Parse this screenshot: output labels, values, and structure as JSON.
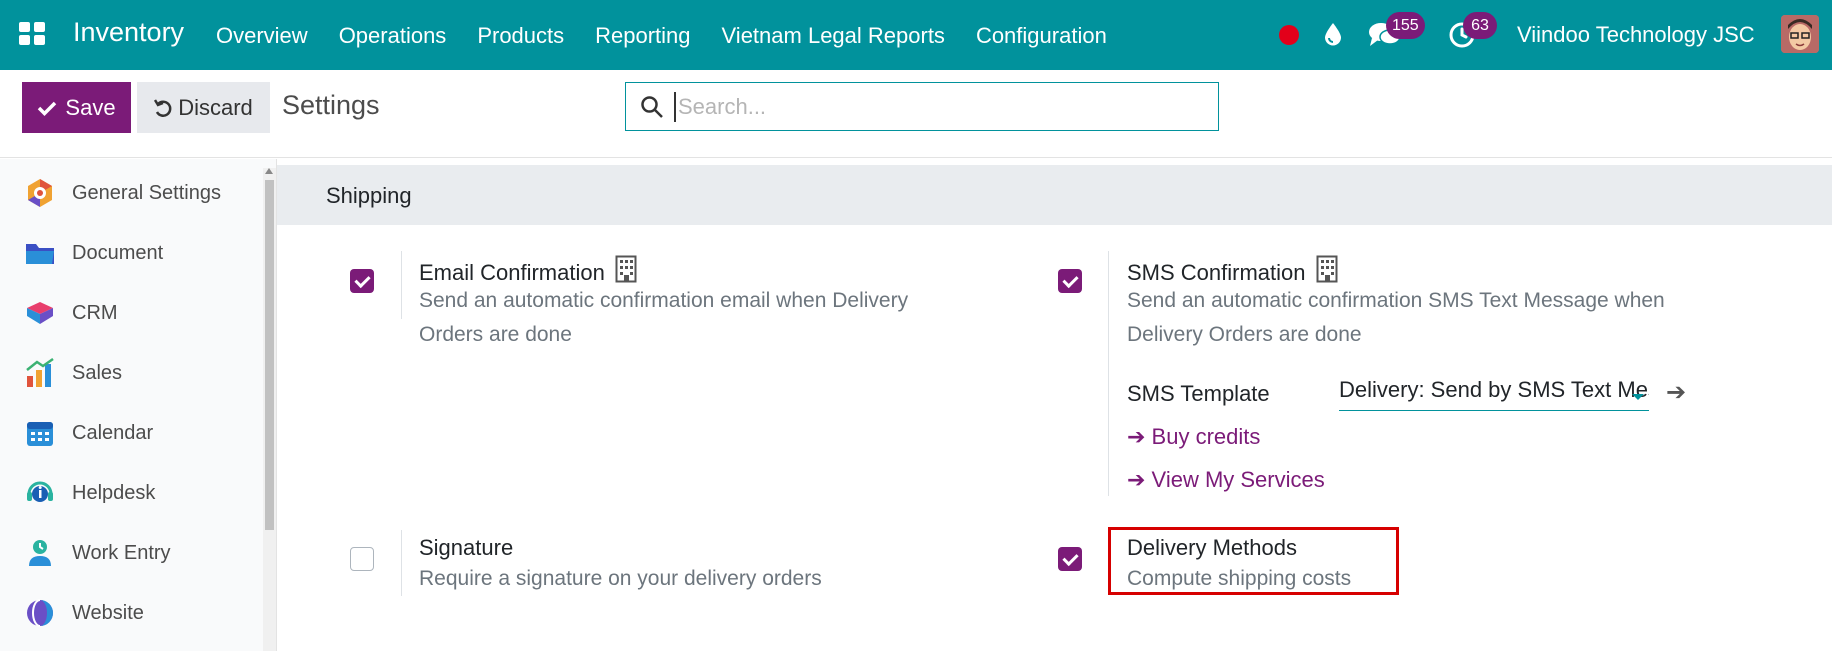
{
  "navbar": {
    "app_name": "Inventory",
    "menu": [
      "Overview",
      "Operations",
      "Products",
      "Reporting",
      "Vietnam Legal Reports",
      "Configuration"
    ],
    "messages_count": "155",
    "activities_count": "63",
    "company": "Viindoo Technology JSC",
    "accent_color": "#01929c"
  },
  "control_panel": {
    "save_label": "Save",
    "discard_label": "Discard",
    "title": "Settings",
    "search_placeholder": "Search...",
    "search_value": ""
  },
  "sidebar": {
    "items": [
      {
        "label": "General Settings",
        "icon": "general-settings-icon"
      },
      {
        "label": "Document",
        "icon": "folder-icon"
      },
      {
        "label": "CRM",
        "icon": "crm-icon"
      },
      {
        "label": "Sales",
        "icon": "sales-chart-icon"
      },
      {
        "label": "Calendar",
        "icon": "calendar-icon"
      },
      {
        "label": "Helpdesk",
        "icon": "headset-icon"
      },
      {
        "label": "Work Entry",
        "icon": "work-entry-icon"
      },
      {
        "label": "Website",
        "icon": "website-icon"
      }
    ]
  },
  "section": {
    "title": "Shipping",
    "settings": {
      "email_confirmation": {
        "label": "Email Confirmation",
        "desc1": "Send an automatic confirmation email when Delivery",
        "desc2": "Orders are done",
        "checked": true
      },
      "sms_confirmation": {
        "label": "SMS Confirmation",
        "desc1": "Send an automatic confirmation SMS Text Message when",
        "desc2": "Delivery Orders are done",
        "checked": true,
        "template_label": "SMS Template",
        "template_value": "Delivery: Send by SMS Text Message",
        "buy_credits": "Buy credits",
        "view_services": "View My Services"
      },
      "signature": {
        "label": "Signature",
        "desc": "Require a signature on your delivery orders",
        "checked": false
      },
      "delivery_methods": {
        "label": "Delivery Methods",
        "desc": "Compute shipping costs",
        "checked": true
      }
    }
  },
  "colors": {
    "brand": "#7b1b78",
    "highlight": "#d60000"
  }
}
